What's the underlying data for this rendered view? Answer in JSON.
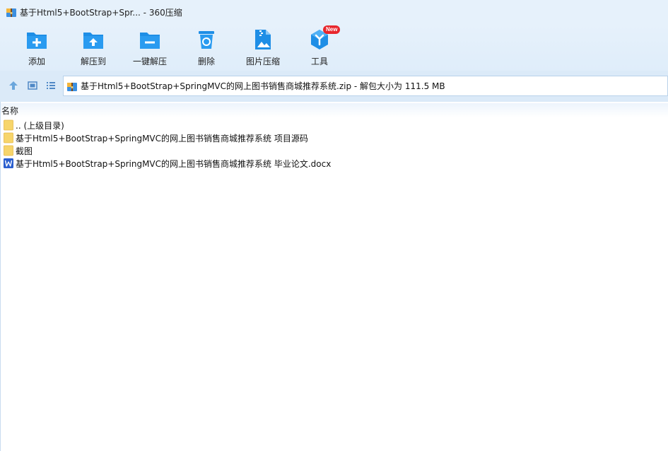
{
  "window": {
    "title": "基于Html5+BootStrap+Spr... - 360压缩",
    "app_icon": "archive-icon"
  },
  "toolbar": {
    "items": [
      {
        "label": "添加",
        "icon": "add-folder-icon"
      },
      {
        "label": "解压到",
        "icon": "extract-to-folder-icon"
      },
      {
        "label": "一键解压",
        "icon": "one-click-extract-icon"
      },
      {
        "label": "删除",
        "icon": "delete-icon"
      },
      {
        "label": "图片压缩",
        "icon": "image-compress-icon"
      },
      {
        "label": "工具",
        "icon": "tools-icon",
        "badge": "New"
      }
    ]
  },
  "nav": {
    "path": "基于Html5+BootStrap+SpringMVC的网上图书销售商城推荐系统.zip - 解包大小为 111.5 MB"
  },
  "list": {
    "column_name": "名称",
    "rows": [
      {
        "name": ".. (上级目录)",
        "type": "folder"
      },
      {
        "name": "基于Html5+BootStrap+SpringMVC的网上图书销售商城推荐系统 项目源码",
        "type": "folder"
      },
      {
        "name": "截图",
        "type": "folder"
      },
      {
        "name": "基于Html5+BootStrap+SpringMVC的网上图书销售商城推荐系统 毕业论文.docx",
        "type": "word"
      }
    ]
  },
  "colors": {
    "accent": "#1e8ee6",
    "toolbar_bg": "#e6f1fb",
    "folder": "#f7d56b",
    "word": "#2b5fcf",
    "badge": "#e8262c"
  }
}
